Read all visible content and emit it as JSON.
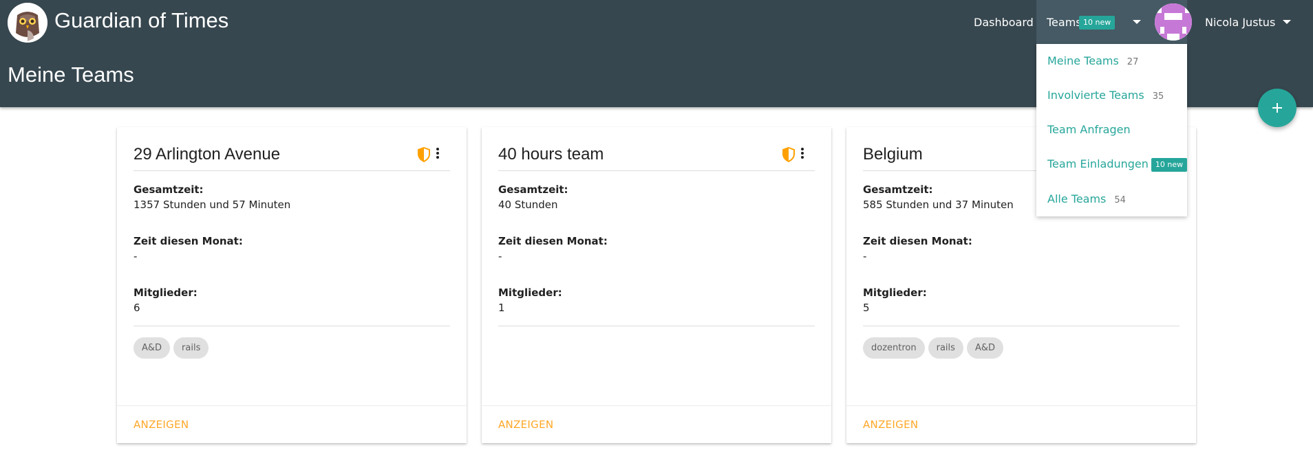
{
  "app": {
    "brand": "Guardian of Times",
    "page_title": "Meine Teams"
  },
  "nav": {
    "dashboard": "Dashboard",
    "teams_label": "Teams",
    "teams_badge": "10 new",
    "user_name": "Nicola Justus"
  },
  "dropdown": {
    "items": [
      {
        "label": "Meine Teams",
        "count": "27"
      },
      {
        "label": "Involvierte Teams",
        "count": "35"
      },
      {
        "label": "Team Anfragen"
      },
      {
        "label": "Team Einladungen",
        "badge": "10 new"
      },
      {
        "label": "Alle Teams",
        "count": "54"
      }
    ]
  },
  "labels": {
    "total_time": "Gesamtzeit:",
    "month_time": "Zeit diesen Monat:",
    "members": "Mitglieder:",
    "show": "Anzeigen"
  },
  "cards": [
    {
      "title": "29 Arlington Avenue",
      "total": "1357 Stunden und 57 Minuten",
      "month": "-",
      "members": "6",
      "tags": [
        "A&D",
        "rails"
      ],
      "shield": true
    },
    {
      "title": "40 hours team",
      "total": "40 Stunden",
      "month": "-",
      "members": "1",
      "tags": [],
      "shield": true
    },
    {
      "title": "Belgium",
      "total": "585 Stunden und 37 Minuten",
      "month": "-",
      "members": "5",
      "tags": [
        "dozentron",
        "rails",
        "A&D"
      ],
      "shield": false
    }
  ],
  "colors": {
    "header": "#37474f",
    "accent": "#26a69a",
    "link": "#ffa726",
    "shield": "#ffa000"
  },
  "icons": {
    "fab": "plus-icon",
    "shield": "shield-icon",
    "menu": "more-vert-icon"
  }
}
